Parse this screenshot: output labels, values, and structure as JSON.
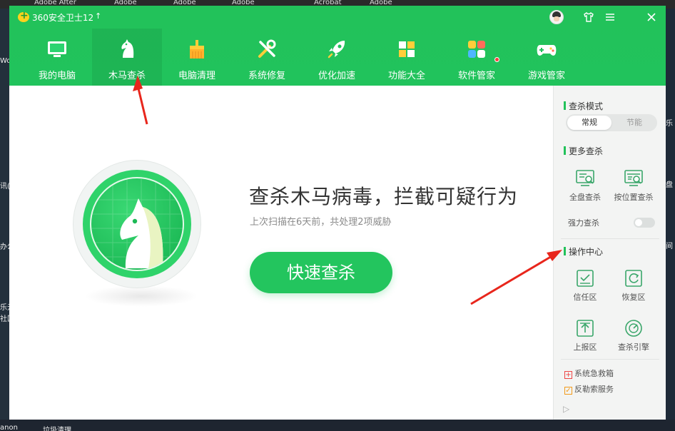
{
  "desktop": {
    "top_labels": [
      "",
      "Adobe After",
      "Adobe",
      "Adobe",
      "Adobe",
      "Acrobat",
      "Adobe"
    ],
    "left_labels": [
      "",
      "Wo",
      "",
      "讯(",
      "",
      "办公",
      "",
      "乐元",
      "社区"
    ],
    "right_labels": [
      "",
      "乐",
      "",
      "盘",
      "",
      "间"
    ],
    "bottom_labels": [
      "anon",
      "垃圾清理"
    ]
  },
  "window": {
    "title": "360安全卫士12",
    "update_arrow": "↑",
    "controls": {
      "skin": "⛉",
      "menu": "☰",
      "close": "✕"
    }
  },
  "nav": [
    {
      "label": "我的电脑",
      "icon": "computer-icon",
      "active": false
    },
    {
      "label": "木马查杀",
      "icon": "horse-icon",
      "active": true
    },
    {
      "label": "电脑清理",
      "icon": "broom-icon",
      "active": false
    },
    {
      "label": "系统修复",
      "icon": "tools-icon",
      "active": false
    },
    {
      "label": "优化加速",
      "icon": "rocket-icon",
      "active": false
    },
    {
      "label": "功能大全",
      "icon": "grid-icon",
      "active": false
    },
    {
      "label": "软件管家",
      "icon": "apps-icon",
      "active": false,
      "badge": true
    },
    {
      "label": "游戏管家",
      "icon": "gamepad-icon",
      "active": false
    }
  ],
  "main": {
    "headline": "查杀木马病毒，拦截可疑行为",
    "subline": "上次扫描在6天前，共处理2项威胁",
    "scan_button": "快速查杀"
  },
  "panel": {
    "mode_title": "查杀模式",
    "mode_options": [
      "常规",
      "节能"
    ],
    "mode_selected": "常规",
    "more_title": "更多查杀",
    "more_tools": [
      "全盘查杀",
      "按位置查杀"
    ],
    "force_label": "强力查杀",
    "force_on": false,
    "ops_title": "操作中心",
    "ops_tools": [
      "信任区",
      "恢复区",
      "上报区",
      "查杀引擎"
    ],
    "links": [
      "系统急救箱",
      "反勒索服务"
    ],
    "collapse": "▷"
  },
  "colors": {
    "brand_green": "#22c25a",
    "annotation_red": "#e8261c"
  }
}
